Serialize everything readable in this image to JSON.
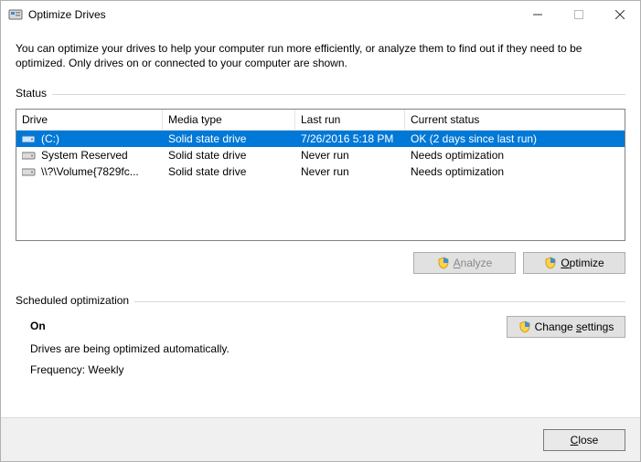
{
  "window": {
    "title": "Optimize Drives"
  },
  "intro": "You can optimize your drives to help your computer run more efficiently, or analyze them to find out if they need to be optimized. Only drives on or connected to your computer are shown.",
  "status": {
    "label": "Status",
    "columns": {
      "drive": "Drive",
      "media": "Media type",
      "last": "Last run",
      "current": "Current status"
    },
    "rows": [
      {
        "drive": "(C:)",
        "media": "Solid state drive",
        "last": "7/26/2016 5:18 PM",
        "current": "OK (2 days since last run)",
        "selected": true,
        "iconColor": "blue"
      },
      {
        "drive": "System Reserved",
        "media": "Solid state drive",
        "last": "Never run",
        "current": "Needs optimization",
        "selected": false,
        "iconColor": "gray"
      },
      {
        "drive": "\\\\?\\Volume{7829fc...",
        "media": "Solid state drive",
        "last": "Never run",
        "current": "Needs optimization",
        "selected": false,
        "iconColor": "gray"
      }
    ]
  },
  "buttons": {
    "analyze": "Analyze",
    "optimize": "Optimize",
    "change": "Change settings",
    "close": "Close"
  },
  "scheduled": {
    "label": "Scheduled optimization",
    "state": "On",
    "desc": "Drives are being optimized automatically.",
    "freq": "Frequency: Weekly"
  }
}
